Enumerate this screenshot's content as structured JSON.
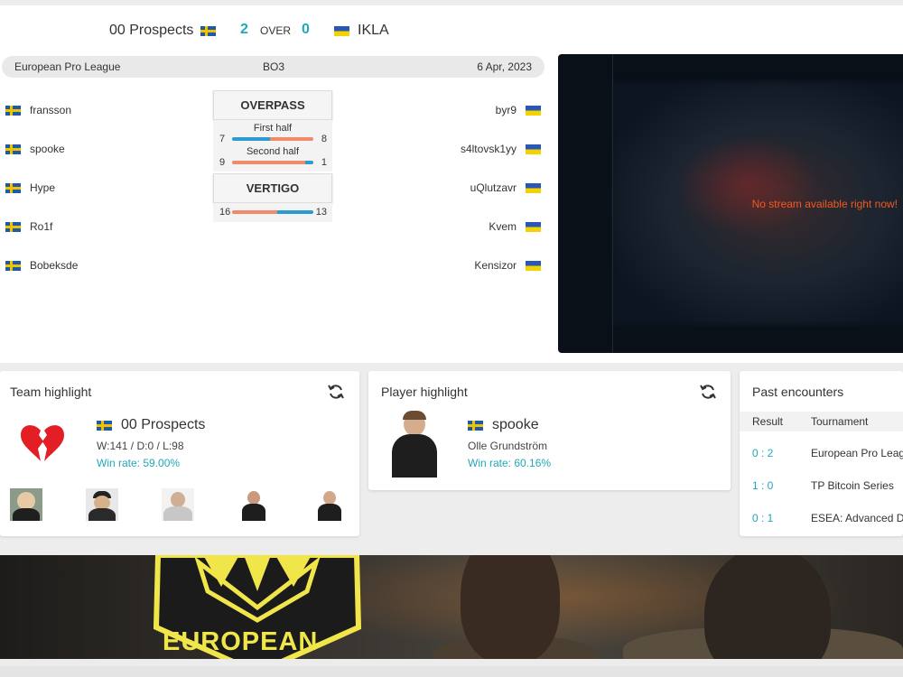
{
  "match": {
    "team1": "00 Prospects",
    "team1_flag": "se",
    "team2": "IKLA",
    "team2_flag": "ua",
    "score1": "2",
    "separator": "OVER",
    "score2": "0",
    "league": "European Pro League",
    "format": "BO3",
    "date": "6 Apr, 2023"
  },
  "players_left": [
    {
      "name": "fransson",
      "flag": "se"
    },
    {
      "name": "spooke",
      "flag": "se"
    },
    {
      "name": "Hype",
      "flag": "se"
    },
    {
      "name": "Ro1f",
      "flag": "se"
    },
    {
      "name": "Bobeksde",
      "flag": "se"
    }
  ],
  "players_right": [
    {
      "name": "byr9",
      "flag": "ua"
    },
    {
      "name": "s4ltovsk1yy",
      "flag": "ua"
    },
    {
      "name": "uQlutzavr",
      "flag": "ua"
    },
    {
      "name": "Kvem",
      "flag": "ua"
    },
    {
      "name": "Kensizor",
      "flag": "ua"
    }
  ],
  "maps": [
    {
      "name": "OVERPASS",
      "halves": [
        {
          "label": "First half",
          "left": "7",
          "right": "8",
          "left_share": 0.47
        },
        {
          "label": "Second half",
          "left": "9",
          "right": "1",
          "left_share": 0.9
        }
      ]
    },
    {
      "name": "VERTIGO",
      "total": {
        "left": "16",
        "right": "13",
        "left_share": 0.55
      }
    }
  ],
  "stream": {
    "message": "No stream available right now!"
  },
  "team_highlight": {
    "title": "Team highlight",
    "name": "00 Prospects",
    "flag": "se",
    "record": "W:141 / D:0 / L:98",
    "winrate": "Win rate: 59.00%",
    "logo_icon": "broken-heart-icon",
    "roster_count": 5
  },
  "player_highlight": {
    "title": "Player highlight",
    "nick": "spooke",
    "flag": "se",
    "real_name": "Olle Grundström",
    "winrate": "Win rate: 60.16%"
  },
  "past_encounters": {
    "title": "Past encounters",
    "headers": [
      "Result",
      "Tournament"
    ],
    "rows": [
      {
        "result": "0 : 2",
        "tournament": "European Pro League"
      },
      {
        "result": "1 : 0",
        "tournament": "TP Bitcoin Series"
      },
      {
        "result": "0 : 1",
        "tournament": "ESEA: Advanced Division"
      }
    ]
  },
  "banner": {
    "text": "EUROPEAN"
  },
  "colors": {
    "accent": "#21a8b8",
    "bar_left": "#2d9bd1",
    "bar_right": "#ef8a6a",
    "stream_msg": "#f05a22",
    "banner_yellow": "#f0e64a"
  }
}
